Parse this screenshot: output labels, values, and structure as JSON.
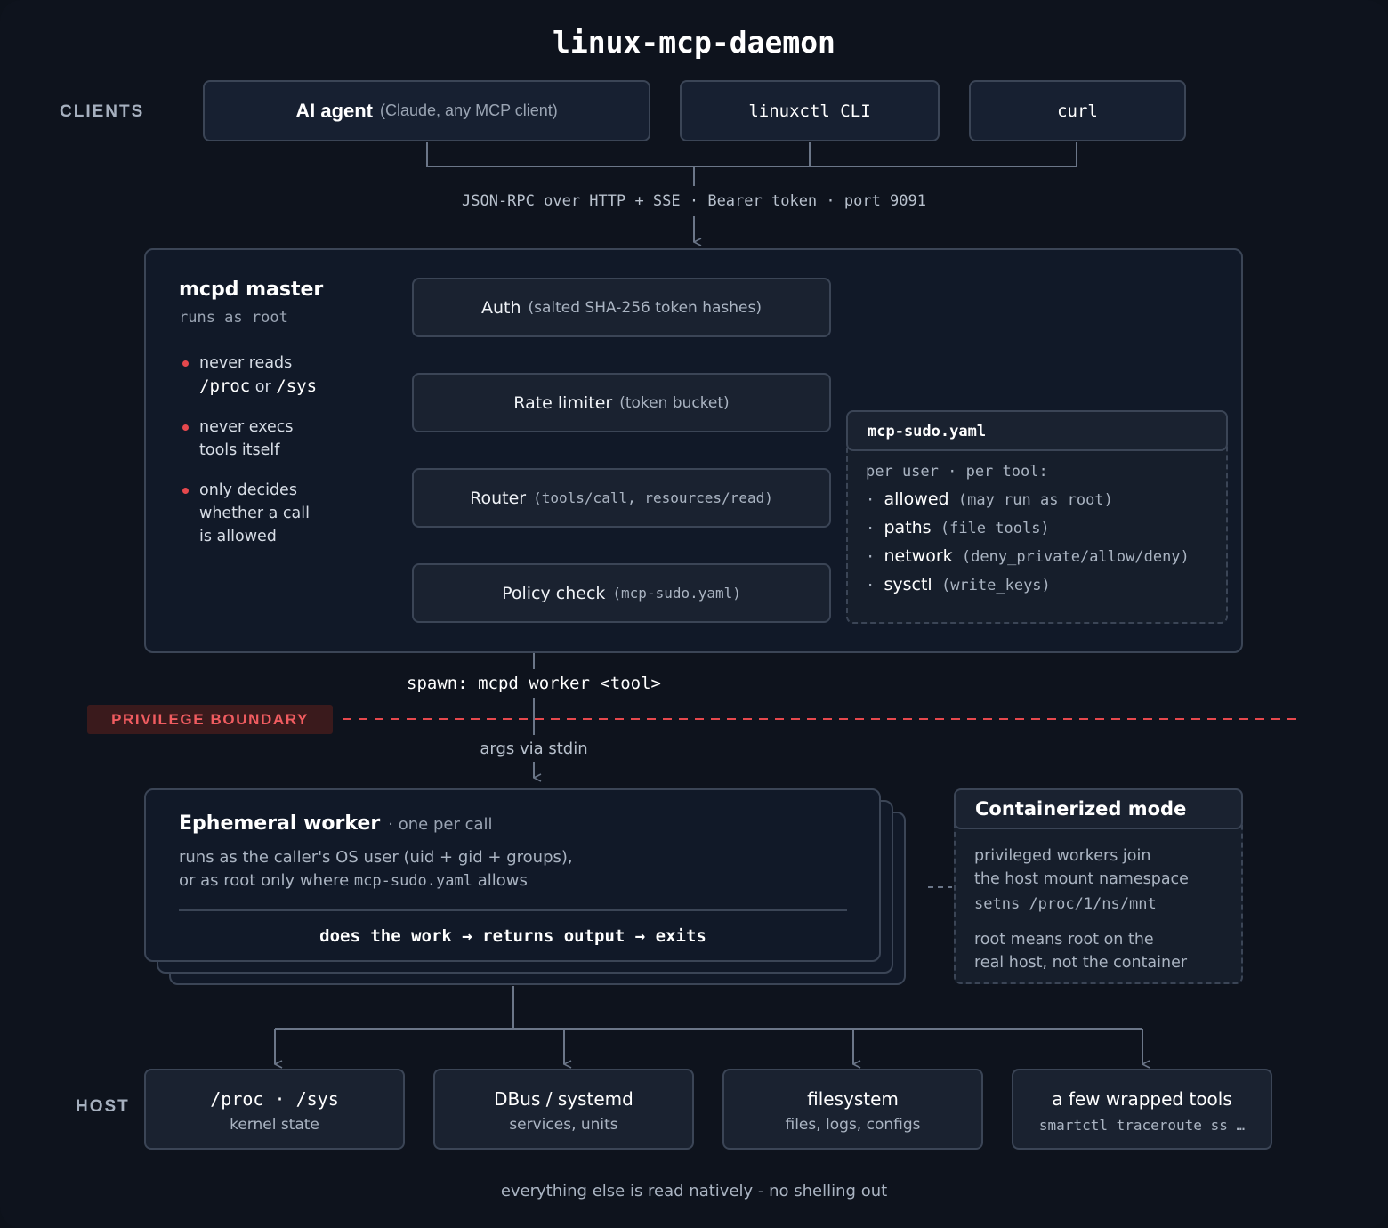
{
  "title": "linux-mcp-daemon",
  "lanes": {
    "clients": "CLIENTS",
    "host": "HOST",
    "boundary": "PRIVILEGE BOUNDARY"
  },
  "clients": {
    "ai_agent": {
      "name": "AI agent",
      "detail": "(Claude, any MCP client)"
    },
    "cli": "linuxctl CLI",
    "curl": "curl"
  },
  "transport_label": "JSON-RPC over HTTP + SSE · Bearer token · port 9091",
  "master": {
    "title": "mcpd master",
    "subtitle": "runs as root",
    "notes": [
      {
        "line1": "never reads",
        "line2_a": "/proc",
        "line2_b": "or",
        "line2_c": "/sys"
      },
      {
        "line1": "never execs",
        "line2": "tools itself"
      },
      {
        "line1": "only decides",
        "line2": "whether a call",
        "line3": "is allowed"
      }
    ],
    "pipeline": [
      {
        "name": "Auth",
        "detail": "(salted SHA-256 token hashes)"
      },
      {
        "name": "Rate limiter",
        "detail": "(token bucket)"
      },
      {
        "name": "Router",
        "detail": "(tools/call, resources/read)"
      },
      {
        "name": "Policy check",
        "detail": "(mcp-sudo.yaml)"
      }
    ]
  },
  "policy_file": {
    "title": "mcp-sudo.yaml",
    "intro": "per user · per tool:",
    "rules": [
      {
        "key": "allowed",
        "detail": "(may run as root)"
      },
      {
        "key": "paths",
        "detail": "(file tools)"
      },
      {
        "key": "network",
        "detail": "(deny_private/allow/deny)"
      },
      {
        "key": "sysctl",
        "detail": "(write_keys)"
      }
    ]
  },
  "spawn_label": "spawn: mcpd worker <tool>",
  "args_label": "args via stdin",
  "worker": {
    "title": "Ephemeral worker",
    "badge": "· one per call",
    "line1": "runs as the caller's OS user (uid + gid + groups),",
    "line2_a": "or as root only where",
    "line2_b": "mcp-sudo.yaml",
    "line2_c": "allows",
    "flow": "does the work → returns output → exits"
  },
  "container": {
    "title": "Containerized mode",
    "line1": "privileged workers join",
    "line2": "the host mount namespace",
    "code": "setns /proc/1/ns/mnt",
    "line3": "root means root on the",
    "line4": "real host, not the container"
  },
  "host_targets": [
    {
      "title": "/proc · /sys",
      "sub": "kernel state"
    },
    {
      "title": "DBus / systemd",
      "sub": "services, units"
    },
    {
      "title": "filesystem",
      "sub": "files, logs, configs"
    },
    {
      "title": "a few wrapped tools",
      "sub": "smartctl traceroute ss …"
    }
  ],
  "footer": "everything else is read natively - no shelling out",
  "colors": {
    "background": "#0e131d",
    "box": "#1a2230",
    "border": "#3b4556",
    "boundary": "#e5484d",
    "boundary_badge": "#3a1a1c"
  }
}
